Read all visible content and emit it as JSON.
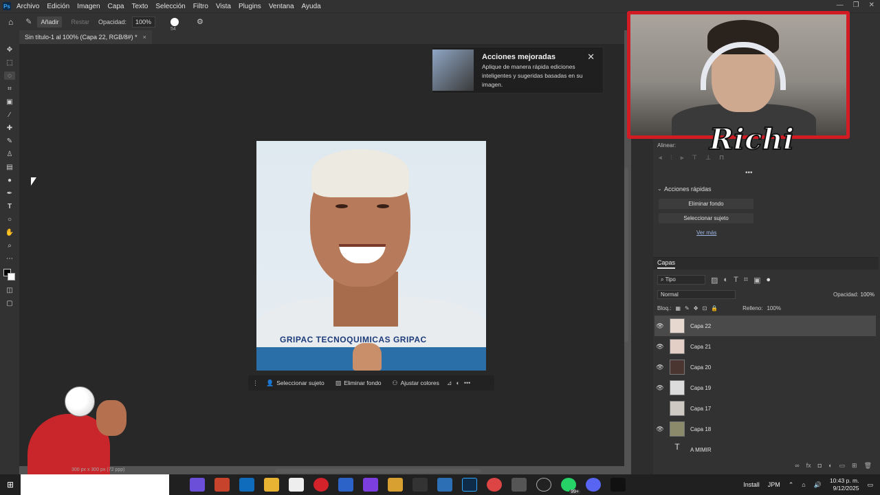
{
  "menubar": {
    "items": [
      "Archivo",
      "Edición",
      "Imagen",
      "Capa",
      "Texto",
      "Selección",
      "Filtro",
      "Vista",
      "Plugins",
      "Ventana",
      "Ayuda"
    ]
  },
  "options": {
    "add_label": "Añadir",
    "subtract_label": "Restar",
    "opacity_label": "Opacidad:",
    "opacity_value": "100%",
    "brush_size": "54"
  },
  "document": {
    "tab_title": "Sin título-1 al 100% (Capa 22, RGB/8#) *",
    "status": "300 px x 300 px (72 ppp)",
    "sponsor_text": "GRIPAC TECNOQUIMICAS GRIPAC"
  },
  "notification": {
    "title": "Acciones mejoradas",
    "body": "Aplique de manera rápida ediciones inteligentes y sugeridas basadas en su imagen."
  },
  "context_bar": {
    "select_subject": "Seleccionar sujeto",
    "remove_bg": "Eliminar fondo",
    "adjust_colors": "Ajustar colores"
  },
  "right_panel": {
    "align_label": "Alinear:",
    "quick_actions_title": "Acciones rápidas",
    "remove_bg": "Eliminar fondo",
    "select_subject": "Seleccionar sujeto",
    "see_more": "Ver más",
    "layers_tab": "Capas",
    "filter_type": "Tipo",
    "blend_mode": "Normal",
    "opacity_label": "Opacidad:",
    "opacity_value": "100%",
    "lock_label": "Bloq.:",
    "fill_label": "Relleno:",
    "fill_value": "100%",
    "layers": [
      {
        "name": "Capa 22",
        "visible": true,
        "selected": true
      },
      {
        "name": "Capa 21",
        "visible": true,
        "selected": false
      },
      {
        "name": "Capa 20",
        "visible": true,
        "selected": false
      },
      {
        "name": "Capa 19",
        "visible": true,
        "selected": false
      },
      {
        "name": "Capa 17",
        "visible": false,
        "selected": false
      },
      {
        "name": "Capa 18",
        "visible": true,
        "selected": false
      },
      {
        "name": "A MIMIR",
        "visible": false,
        "selected": false
      }
    ]
  },
  "overlay": {
    "streamer_name": "Richi"
  },
  "taskbar": {
    "install_label": "Install",
    "lang": "JPM",
    "badge": "99+",
    "time": "10:43 p. m.",
    "date": "9/12/2025"
  },
  "colors": {
    "accent": "#31a8ff",
    "webcam_border": "#d21b22"
  }
}
